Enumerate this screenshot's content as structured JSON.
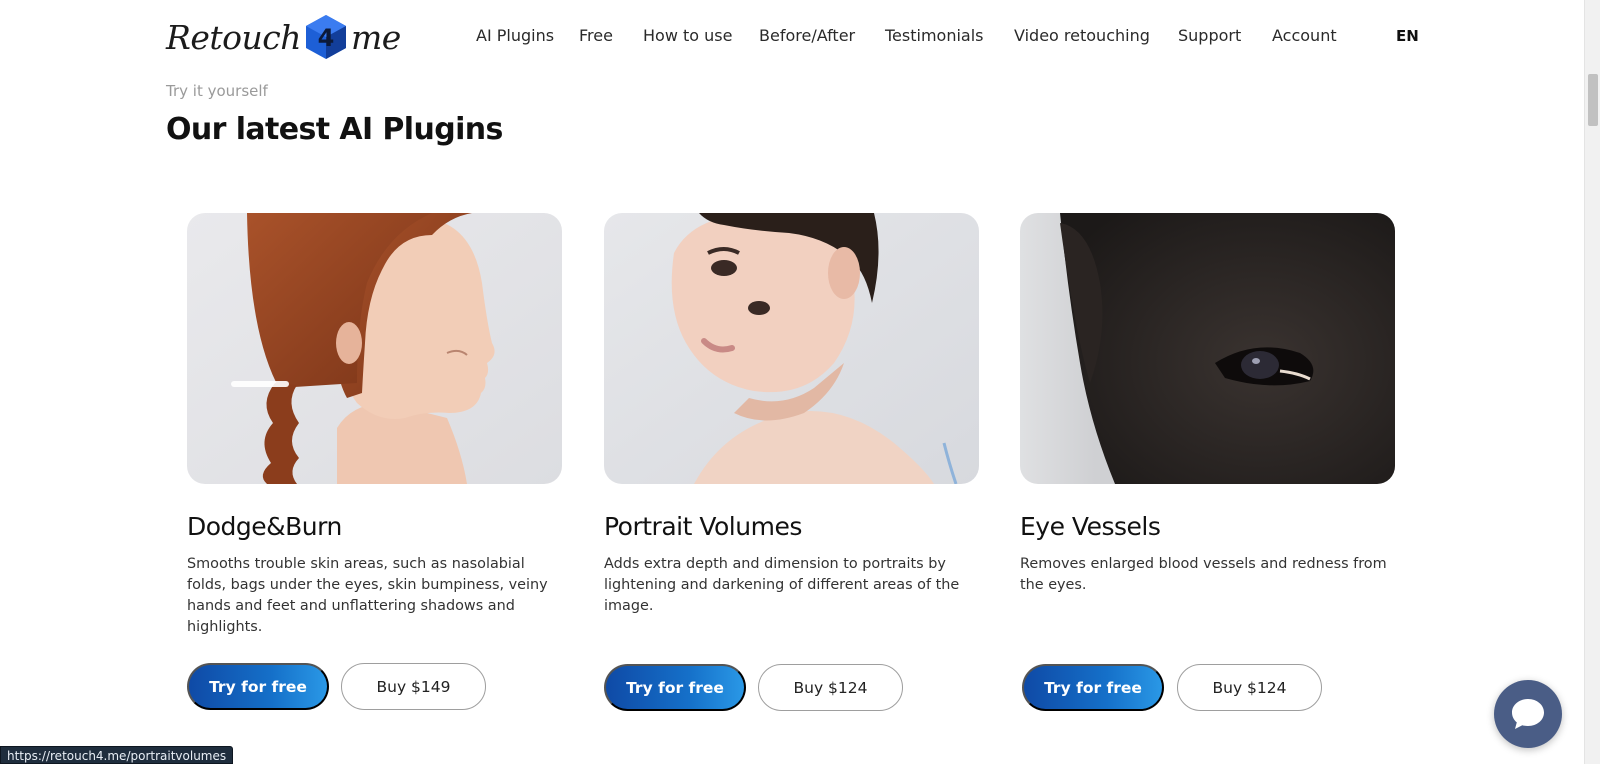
{
  "header": {
    "logo": {
      "text_left": "Retouch",
      "text_right": "me",
      "mark_glyph": "4"
    },
    "nav": [
      {
        "label": "AI Plugins"
      },
      {
        "label": "Free"
      },
      {
        "label": "How to use"
      },
      {
        "label": "Before/After"
      },
      {
        "label": "Testimonials"
      },
      {
        "label": "Video retouching"
      },
      {
        "label": "Support"
      },
      {
        "label": "Account"
      }
    ],
    "language": "EN"
  },
  "section": {
    "eyebrow": "Try it yourself",
    "title": "Our latest AI Plugins"
  },
  "cards": [
    {
      "title": "Dodge&Burn",
      "description": "Smooths trouble skin areas, such as nasolabial folds, bags under the eyes, skin bumpiness, veiny hands and feet and unflattering shadows and highlights.",
      "try_label": "Try for free",
      "buy_label": "Buy $149"
    },
    {
      "title": "Portrait Volumes",
      "description": "Adds extra depth and dimension to portraits by lightening and darkening of different areas of the image.",
      "try_label": "Try for free",
      "buy_label": "Buy $124"
    },
    {
      "title": "Eye Vessels",
      "description": "Removes enlarged blood vessels and redness from the eyes.",
      "try_label": "Try for free",
      "buy_label": "Buy $124"
    }
  ],
  "status_bar": {
    "url": "https://retouch4.me/portraitvolumes"
  },
  "colors": {
    "accent": "#1570c9",
    "accent_dark": "#0f4aa6",
    "chat_bubble": "#4a5d86",
    "logo_blue": "#1d5fd6"
  },
  "icons": {
    "logo_mark": "hexagon-cube-icon",
    "chat": "chat-bubble-icon"
  }
}
